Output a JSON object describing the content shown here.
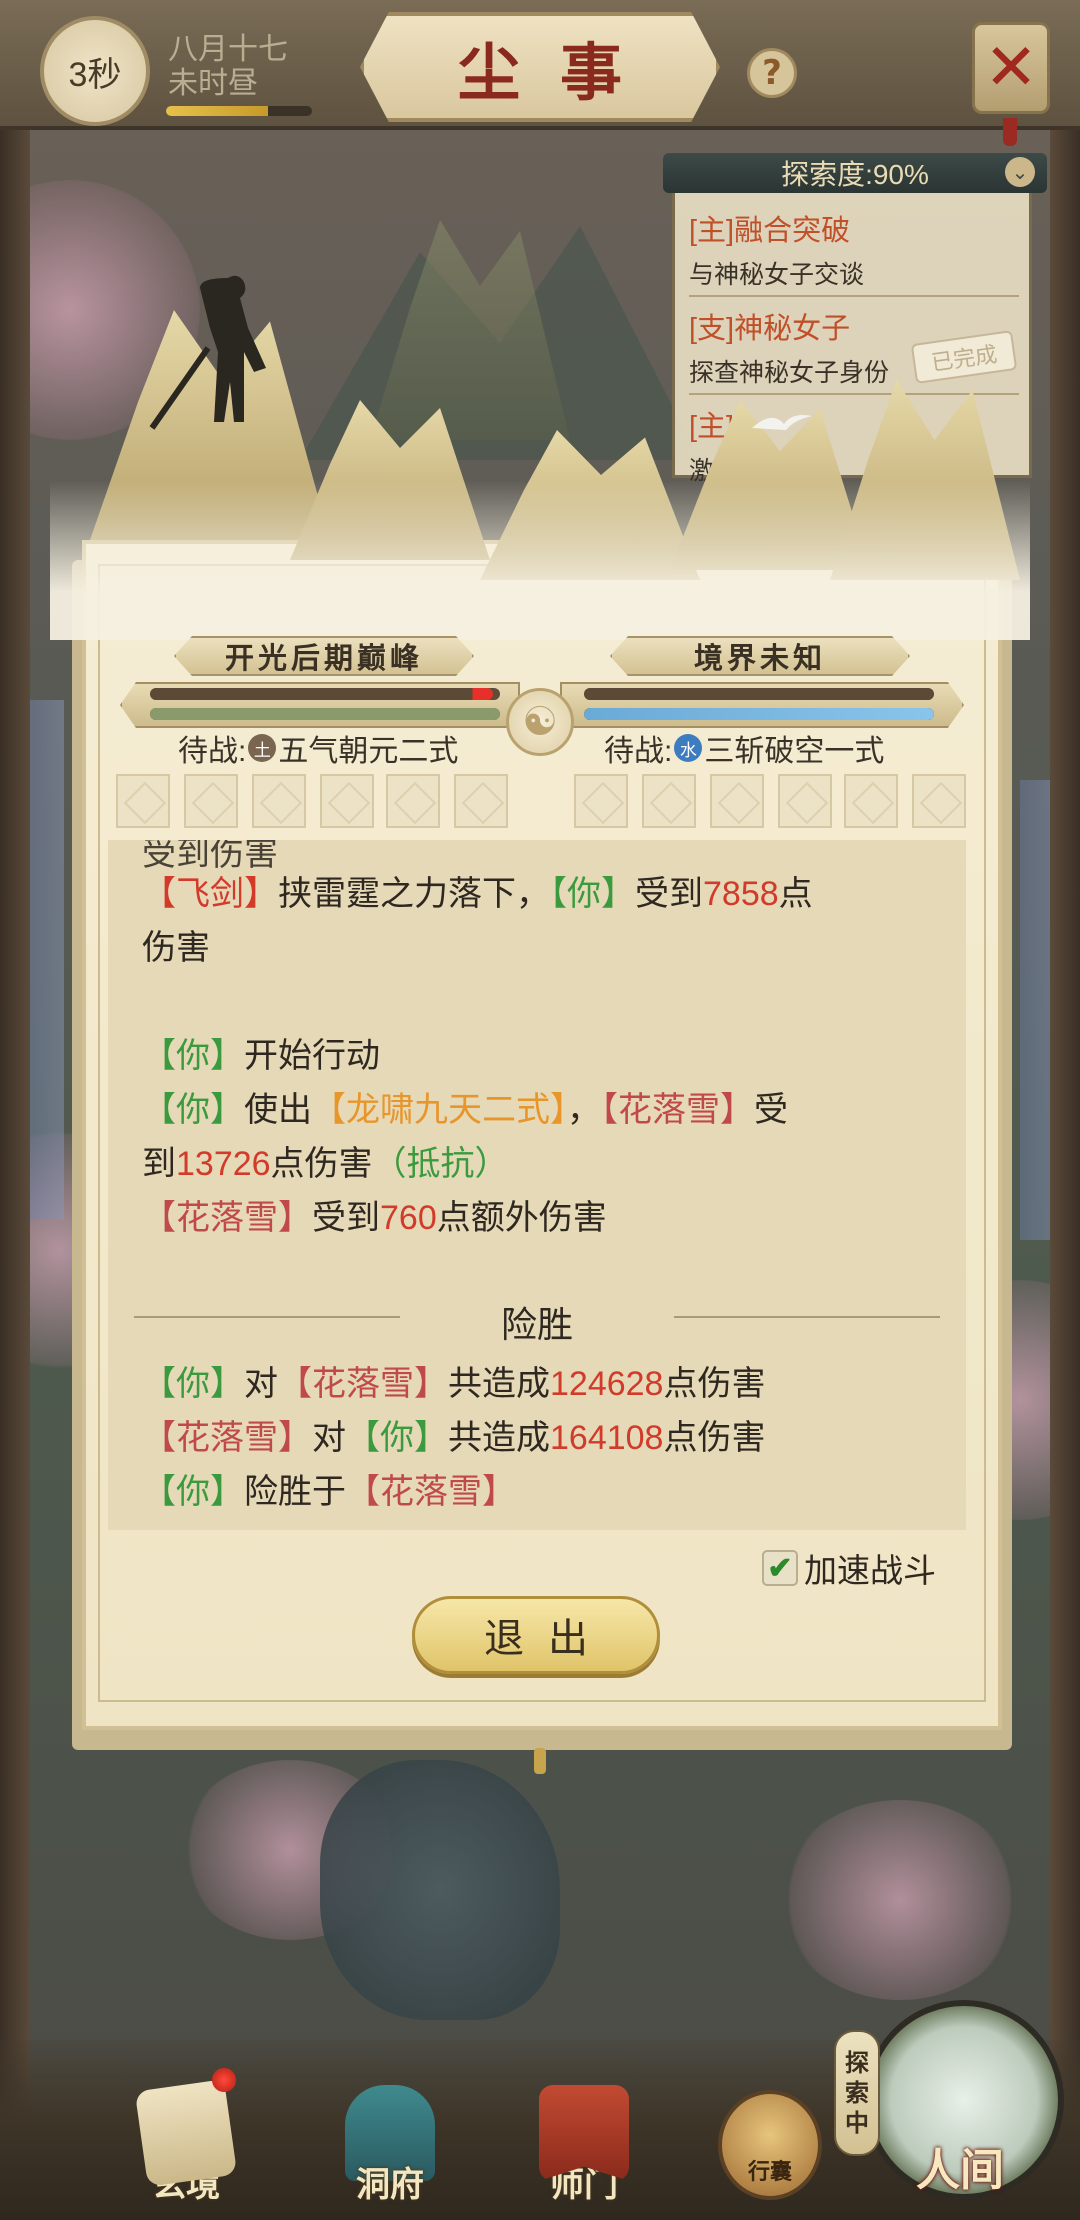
{
  "header": {
    "timer": "3秒",
    "date_line1": "八月十七",
    "date_line2": "未时昼",
    "date_progress": 0.7,
    "title": "尘事",
    "help_icon": "?",
    "close_icon": "✕"
  },
  "quest_panel": {
    "header": "探索度:90%",
    "toggle_icon": "chevron-down",
    "items": [
      {
        "title": "[主]融合突破",
        "desc": "与神秘女子交谈"
      },
      {
        "title": "[支]神秘女子",
        "desc": "探查神秘女子身份",
        "status": "已完成"
      },
      {
        "title": "[主]",
        "desc": "激活"
      }
    ]
  },
  "battle": {
    "player_realm": "开光后期巅峰",
    "enemy_realm": "境界未知",
    "player_hp_fraction": 0.98,
    "player_mp_fraction": 1.0,
    "enemy_hp_fraction": 1.0,
    "enemy_mp_fraction": 1.0,
    "player_standby_label": "待战:",
    "player_element": "土",
    "player_skill": "五气朝元二式",
    "enemy_standby_label": "待战:",
    "enemy_element": "水",
    "enemy_skill": "三斩破空一式"
  },
  "log": {
    "line0": "受到伤害",
    "line1": {
      "a": "【飞剑】",
      "b": "挟雷霆之力落下，",
      "c": "【你】",
      "d": "受到",
      "e": "7858",
      "f": "点"
    },
    "line2": "伤害",
    "line3": {
      "a": "【你】",
      "b": "开始行动"
    },
    "line4": {
      "a": "【你】",
      "b": "使出",
      "c": "【龙啸九天二式】",
      "d": "，",
      "e": "【花落雪】",
      "f": "受"
    },
    "line5": {
      "a": "到",
      "b": "13726",
      "c": "点伤害",
      "d": "（抵抗）"
    },
    "line6": {
      "a": "【花落雪】",
      "b": "受到",
      "c": "760",
      "d": "点额外伤害"
    },
    "result": "险胜",
    "line7": {
      "a": "【你】",
      "b": "对",
      "c": "【花落雪】",
      "d": "共造成",
      "e": "124628",
      "f": "点伤害"
    },
    "line8": {
      "a": "【花落雪】",
      "b": "对",
      "c": "【你】",
      "d": "共造成",
      "e": "164108",
      "f": "点伤害"
    },
    "line9": {
      "a": "【你】",
      "b": "险胜于",
      "c": "【花落雪】"
    }
  },
  "controls": {
    "speed_label": "加速战斗",
    "speed_checked": true,
    "exit_label": "退出"
  },
  "nav": {
    "items": [
      "玄境",
      "洞府",
      "师门"
    ],
    "bag_label": "行囊",
    "explore_tag": [
      "探",
      "索",
      "中"
    ],
    "world_label": "人间"
  },
  "colors": {
    "accent_red": "#d23a2a",
    "accent_green": "#3b9a3e",
    "accent_orange": "#e8952a",
    "parchment": "#f5edd4"
  }
}
